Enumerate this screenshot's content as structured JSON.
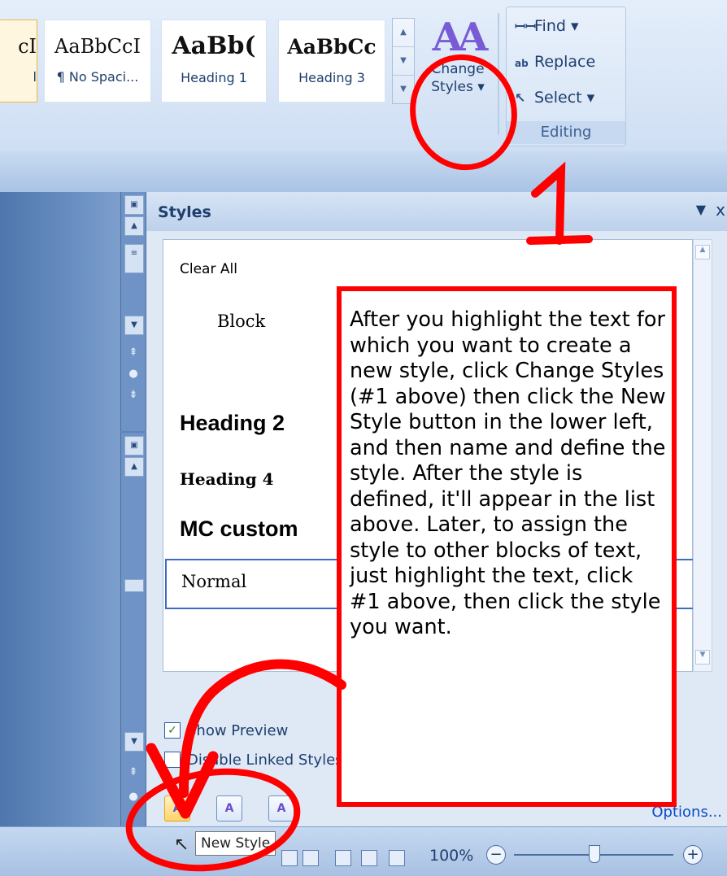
{
  "ribbon": {
    "style_gallery": [
      {
        "sample": "cI",
        "name": "l"
      },
      {
        "sample": "AaBbCcI",
        "name": "¶ No Spaci..."
      },
      {
        "sample": "AaBb(",
        "name": "Heading 1"
      },
      {
        "sample": "AaBbCc",
        "name": "Heading 3"
      }
    ],
    "change_styles": {
      "glyph": "AA",
      "line1": "Change",
      "line2": "Styles ▾"
    },
    "editing": {
      "find": "Find ▾",
      "replace": "Replace",
      "select": "Select ▾",
      "group_label": "Editing"
    }
  },
  "styles_pane": {
    "title": "Styles",
    "menu_glyph": "▼",
    "close_glyph": "x",
    "items": {
      "clear_all": "Clear All",
      "block": "Block",
      "heading2": "Heading 2",
      "heading4": "Heading 4",
      "mc_custom": "MC custom",
      "normal": "Normal"
    },
    "show_preview": "Show Preview",
    "disable_linked": "Disable Linked Styles",
    "buttons": {
      "new_style": "A",
      "style_inspector": "A",
      "manage_styles": "A"
    },
    "options": "Options..."
  },
  "tooltip": {
    "text": "New Style"
  },
  "statusbar": {
    "zoom": "100%",
    "minus": "−",
    "plus": "+"
  },
  "annotation": {
    "number": "1",
    "text": "After you highlight the text for which you want to create a new style, click Change Styles (#1 above) then click the New Style button in the lower left, and then name and define the style.  After the style is defined, it'll appear in the list above.  Later, to assign the style to other blocks of text, just highlight the text, click #1 above, then click the style you want."
  },
  "colors": {
    "annotation_red": "#ff0000",
    "ribbon_blue": "#cfdff3",
    "link_blue": "#0b4bc5"
  }
}
